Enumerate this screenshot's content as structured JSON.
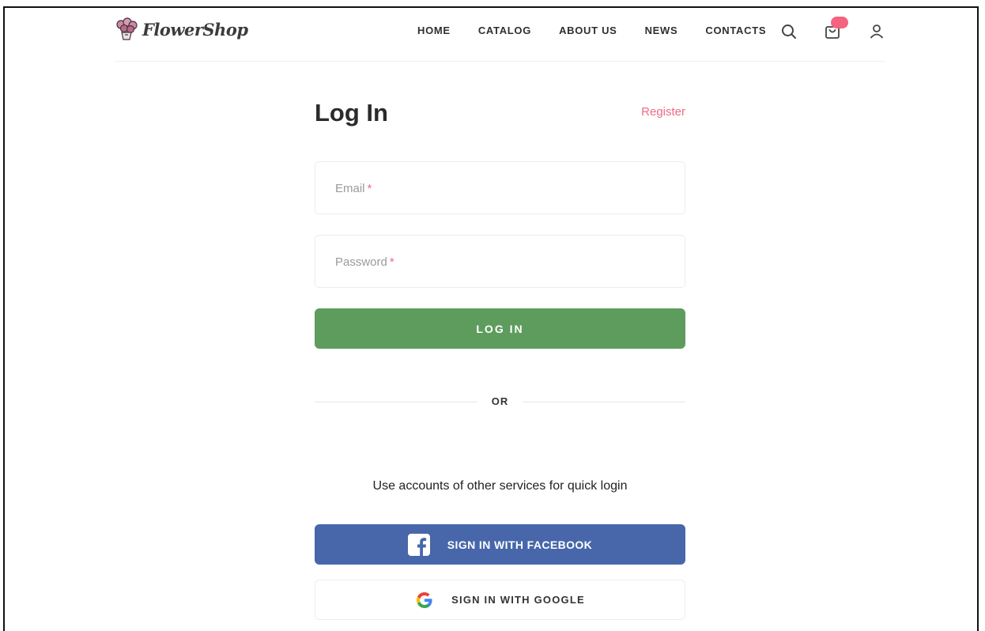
{
  "header": {
    "logo_text": "FlowerShop",
    "nav": [
      {
        "label": "HOME"
      },
      {
        "label": "CATALOG"
      },
      {
        "label": "ABOUT US"
      },
      {
        "label": "NEWS"
      },
      {
        "label": "CONTACTS"
      }
    ]
  },
  "login": {
    "title": "Log In",
    "register_label": "Register",
    "email_label": "Email",
    "password_label": "Password",
    "required_mark": "*",
    "submit_label": "LOG IN",
    "divider_label": "OR",
    "quick_login_text": "Use accounts of other services for quick login",
    "facebook_label": "SIGN IN WITH FACEBOOK",
    "google_label": "SIGN IN WITH GOOGLE"
  },
  "colors": {
    "accent_pink": "#f06987",
    "login_green": "#5e9c5e",
    "facebook_blue": "#4767aa"
  }
}
